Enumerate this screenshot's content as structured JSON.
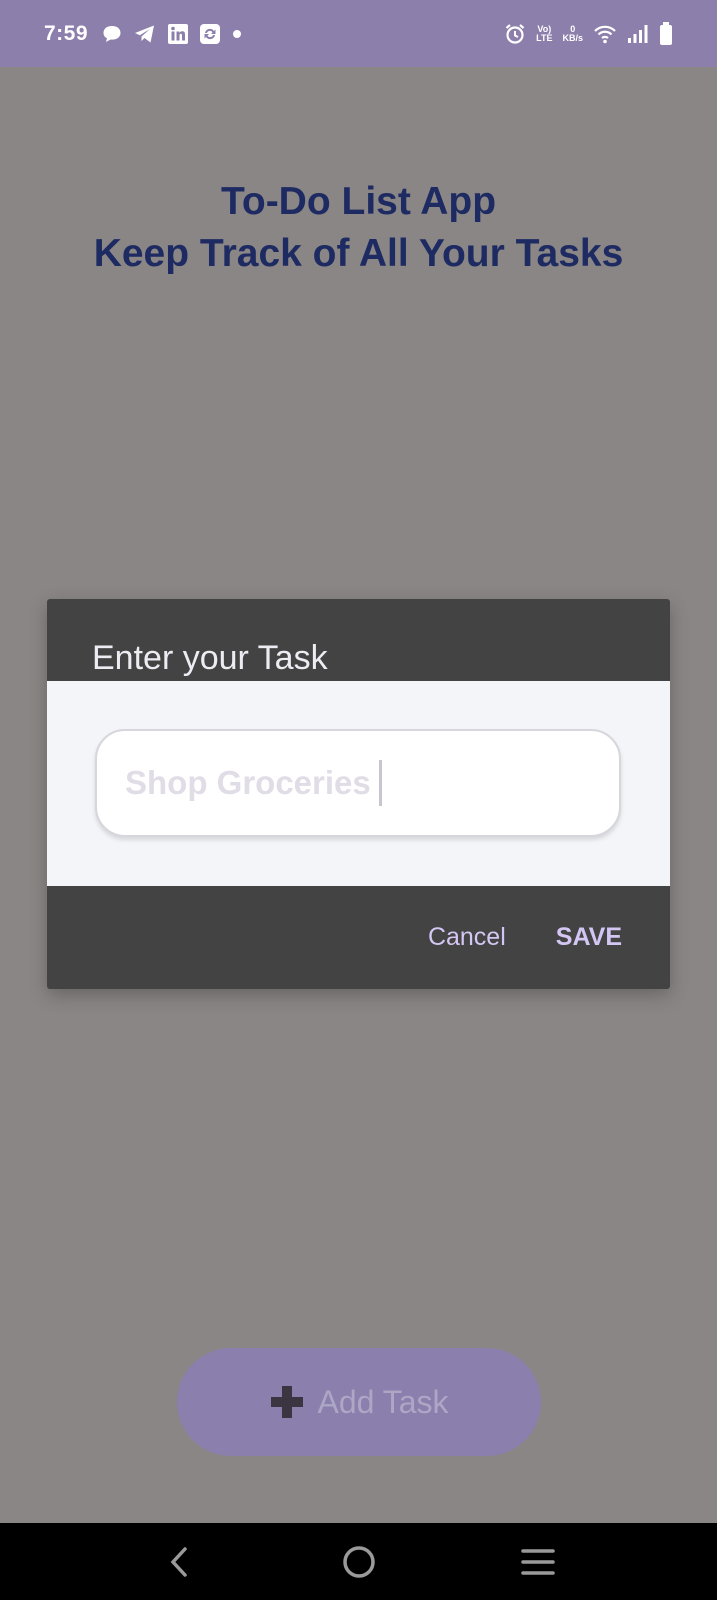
{
  "status_bar": {
    "time": "7:59",
    "left_icons": [
      "chat-bubble-icon",
      "telegram-icon",
      "linkedin-icon",
      "sync-icon",
      "dot-icon"
    ],
    "right_icons": [
      "alarm-icon",
      "volte-icon",
      "data-speed-icon",
      "wifi-icon",
      "signal-icon",
      "battery-icon"
    ],
    "volte_top": "Vo)",
    "volte_bottom": "LTE",
    "speed_value": "0",
    "speed_unit": "KB/s"
  },
  "app": {
    "title_line1": "To-Do List App",
    "title_line2": "Keep Track of All Your Tasks",
    "add_button_label": "Add Task",
    "colors": {
      "background": "#8a8685",
      "status_bar": "#8c7fac",
      "title": "#1e2a62",
      "add_button": "#8b7fad"
    }
  },
  "dialog": {
    "title": "Enter your Task",
    "input_value": "Shop Groceries",
    "cancel_label": "Cancel",
    "save_label": "SAVE",
    "colors": {
      "frame": "#434343",
      "body": "#f3f5f9",
      "action_text": "#d4c6f3"
    }
  },
  "nav_bar": {
    "buttons": [
      "back-icon",
      "home-icon",
      "menu-icon"
    ]
  }
}
